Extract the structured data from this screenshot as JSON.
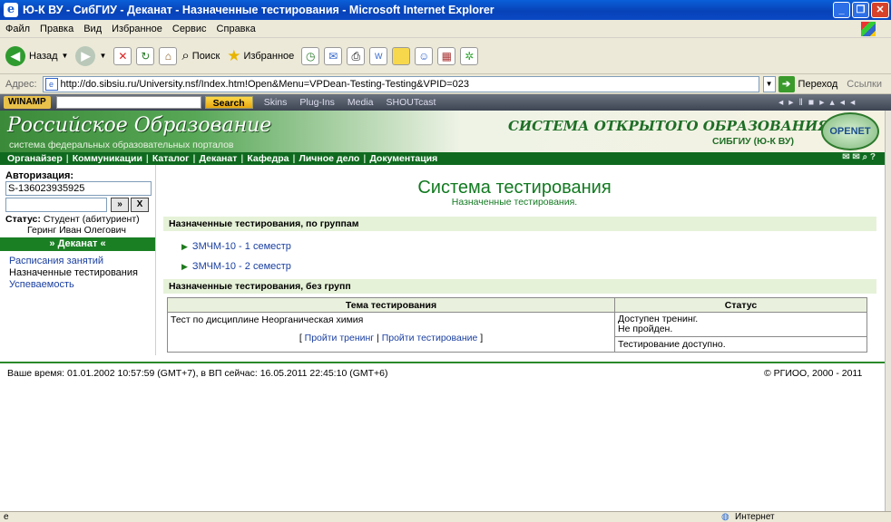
{
  "window": {
    "title": "Ю-К ВУ - СибГИУ - Деканат - Назначенные тестирования - Microsoft Internet Explorer"
  },
  "menu": [
    "Файл",
    "Правка",
    "Вид",
    "Избранное",
    "Сервис",
    "Справка"
  ],
  "toolbar": {
    "back": "Назад",
    "search": "Поиск",
    "favorites": "Избранное"
  },
  "address": {
    "label": "Адрес:",
    "url": "http://do.sibsiu.ru/University.nsf/Index.htm!Open&Menu=VPDean-Testing-Testing&VPID=023",
    "go": "Переход",
    "links": "Ссылки"
  },
  "winamp": {
    "logo": "WINAMP",
    "search_btn": "Search",
    "skins": "Skins",
    "plugins": "Plug-Ins",
    "media": "Media",
    "shoutcast": "SHOUTcast"
  },
  "banner": {
    "brand": "Российское Образование",
    "subtitle": "система федеральных образовательных порталов",
    "system_name": "СИСТЕМА ОТКРЫТОГО ОБРАЗОВАНИЯ",
    "university": "СИБГИУ (Ю-К ВУ)",
    "badge": "OPENET"
  },
  "nav": [
    "Органайзер",
    "Коммуникации",
    "Каталог",
    "Деканат",
    "Кафедра",
    "Личное дело",
    "Документация"
  ],
  "sidebar": {
    "auth_label": "Авторизация:",
    "login_value": "S-136023935925",
    "status_label": "Статус:",
    "status_value": "Студент (абитуриент)",
    "student_name": "Геринг Иван Олегович",
    "section_header": "» Деканат «",
    "links": [
      "Расписания занятий",
      "Назначенные тестирования",
      "Успеваемость"
    ]
  },
  "main": {
    "title": "Система тестирования",
    "subtitle": "Назначенные тестирования.",
    "groups_header": "Назначенные тестирования, по группам",
    "groups": [
      "ЗМЧМ-10 - 1 семестр",
      "ЗМЧМ-10 - 2 семестр"
    ],
    "nogroups_header": "Назначенные тестирования, без групп",
    "table": {
      "columns": [
        "Тема тестирования",
        "Статус"
      ],
      "row_topic": "Тест по дисциплине Неорганическая химия",
      "link_open": "[",
      "link_training": "Пройти тренинг",
      "link_sep": "|",
      "link_testing": "Пройти тестирование",
      "link_close": "]",
      "status_line1": "Доступен тренинг.",
      "status_line2": "Не пройден.",
      "status_line3": "Тестирование доступно."
    }
  },
  "footer": {
    "time": "Ваше время: 01.01.2002 10:57:59 (GMT+7), в ВП сейчас: 16.05.2011 22:45:10 (GMT+6)",
    "copyright": "© РГИОО, 2000 - 2011"
  },
  "statusbar": {
    "zone": "Интернет"
  }
}
